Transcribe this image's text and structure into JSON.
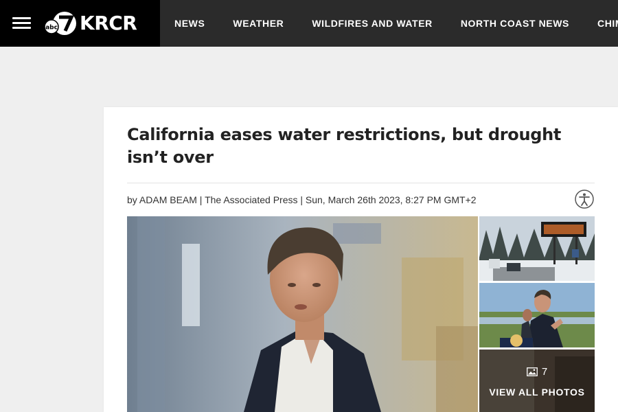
{
  "header": {
    "logo_badge": "abc7",
    "logo_text": "KRCR",
    "nav": [
      "NEWS",
      "WEATHER",
      "WILDFIRES AND WATER",
      "NORTH COAST NEWS",
      "CHIME IN"
    ]
  },
  "article": {
    "headline": "California eases water restrictions, but drought isn’t over",
    "byline": "by ADAM BEAM | The Associated Press | Sun, March 26th 2023, 8:27 PM GMT+2"
  },
  "gallery": {
    "count": "7",
    "view_all_label": "VIEW ALL PHOTOS",
    "icon": "image-icon"
  },
  "colors": {
    "nav_bg": "#2b2b2b",
    "brand_bg": "#000000",
    "page_bg": "#efefef",
    "headline": "#222222"
  }
}
